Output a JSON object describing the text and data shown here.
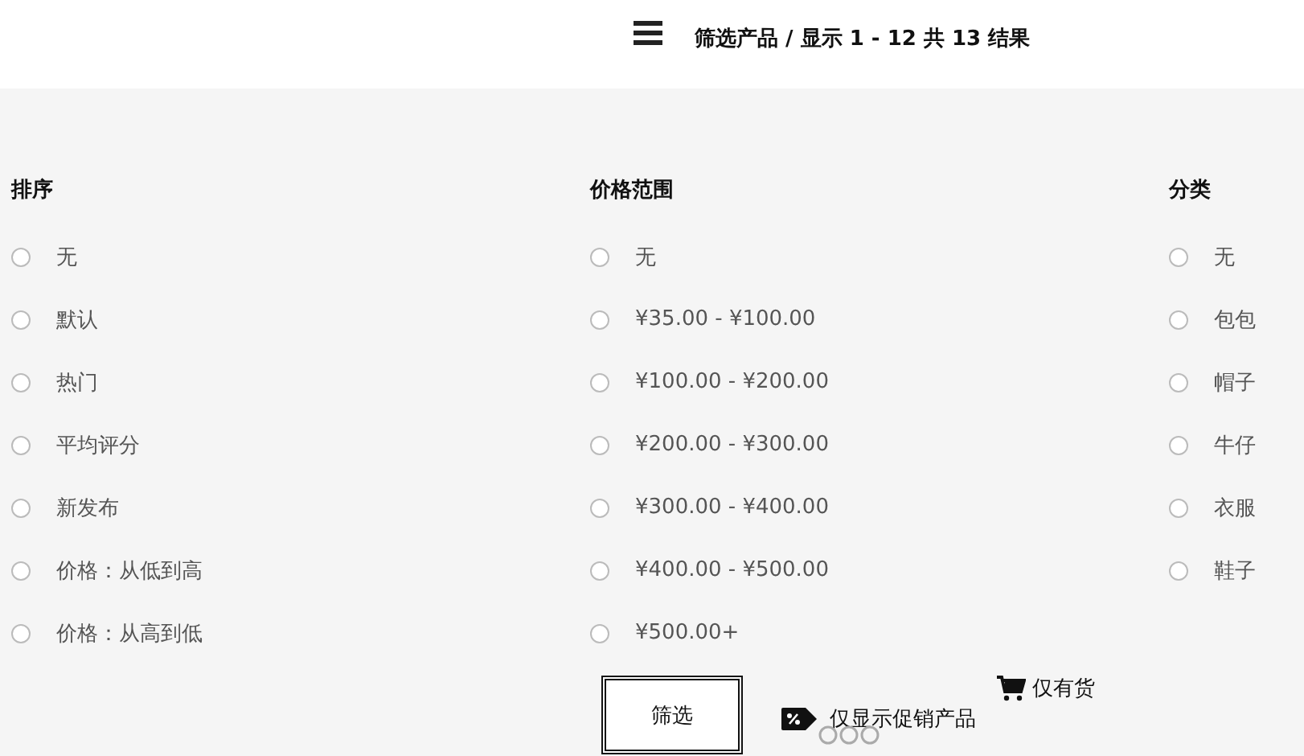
{
  "header": {
    "title": "筛选产品 / 显示 1 - 12 共 13 结果"
  },
  "groups": [
    {
      "title": "排序",
      "options": [
        {
          "label": "无",
          "selected": false
        },
        {
          "label": "默认",
          "selected": false
        },
        {
          "label": "热门",
          "selected": false
        },
        {
          "label": "平均评分",
          "selected": false
        },
        {
          "label": "新发布",
          "selected": false
        },
        {
          "label": "价格：从低到高",
          "selected": false
        },
        {
          "label": "价格：从高到低",
          "selected": false
        }
      ]
    },
    {
      "title": "价格范围",
      "options": [
        {
          "label": "无",
          "selected": false
        },
        {
          "label": "¥35.00 - ¥100.00",
          "selected": false
        },
        {
          "label": "¥100.00 - ¥200.00",
          "selected": false
        },
        {
          "label": "¥200.00 - ¥300.00",
          "selected": false
        },
        {
          "label": "¥300.00 - ¥400.00",
          "selected": false
        },
        {
          "label": "¥400.00 - ¥500.00",
          "selected": false
        },
        {
          "label": "¥500.00+",
          "selected": false
        }
      ]
    },
    {
      "title": "分类",
      "options": [
        {
          "label": "无",
          "selected": false
        },
        {
          "label": "包包",
          "selected": false
        },
        {
          "label": "帽子",
          "selected": false
        },
        {
          "label": "牛仔",
          "selected": false
        },
        {
          "label": "衣服",
          "selected": false
        },
        {
          "label": "鞋子",
          "selected": false
        }
      ]
    }
  ],
  "filter_button": "筛选",
  "in_stock": "仅有货",
  "on_sale": "仅显示促销产品"
}
